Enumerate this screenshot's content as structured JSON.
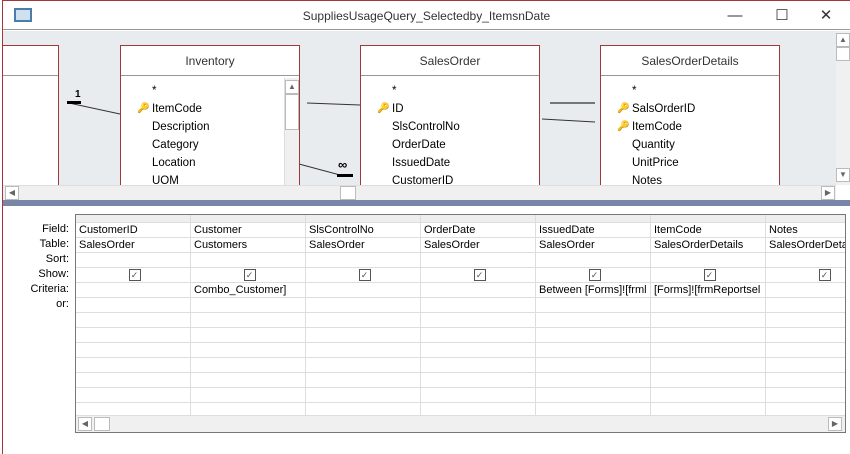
{
  "window": {
    "title": "SuppliesUsageQuery_Selectedby_ItemsnDate",
    "minimize": "—",
    "maximize": "☐",
    "close": "✕"
  },
  "tables": [
    {
      "name": "Inventory",
      "fields": [
        "*",
        "ItemCode",
        "Description",
        "Category",
        "Location",
        "UOM"
      ],
      "keys": [
        1
      ]
    },
    {
      "name": "SalesOrder",
      "fields": [
        "*",
        "ID",
        "SlsControlNo",
        "OrderDate",
        "IssuedDate",
        "CustomerID"
      ],
      "keys": [
        1
      ]
    },
    {
      "name": "SalesOrderDetails",
      "fields": [
        "*",
        "SalsOrderID",
        "ItemCode",
        "Quantity",
        "UnitPrice",
        "Notes"
      ],
      "keys": [
        1,
        2
      ]
    }
  ],
  "relationships": {
    "one_label": "1",
    "many_label": "∞"
  },
  "grid": {
    "row_labels": [
      "Field:",
      "Table:",
      "Sort:",
      "Show:",
      "Criteria:",
      "or:"
    ],
    "columns": [
      {
        "field": "CustomerID",
        "table": "SalesOrder",
        "sort": "",
        "show": true,
        "criteria": ""
      },
      {
        "field": "Customer",
        "table": "Customers",
        "sort": "",
        "show": true,
        "criteria": "Combo_Customer]"
      },
      {
        "field": "SlsControlNo",
        "table": "SalesOrder",
        "sort": "",
        "show": true,
        "criteria": ""
      },
      {
        "field": "OrderDate",
        "table": "SalesOrder",
        "sort": "",
        "show": true,
        "criteria": ""
      },
      {
        "field": "IssuedDate",
        "table": "SalesOrder",
        "sort": "",
        "show": true,
        "criteria": "Between [Forms]![frml"
      },
      {
        "field": "ItemCode",
        "table": "SalesOrderDetails",
        "sort": "",
        "show": true,
        "criteria": "[Forms]![frmReportsel"
      },
      {
        "field": "Notes",
        "table": "SalesOrderDetails",
        "sort": "",
        "show": true,
        "criteria": ""
      }
    ]
  }
}
